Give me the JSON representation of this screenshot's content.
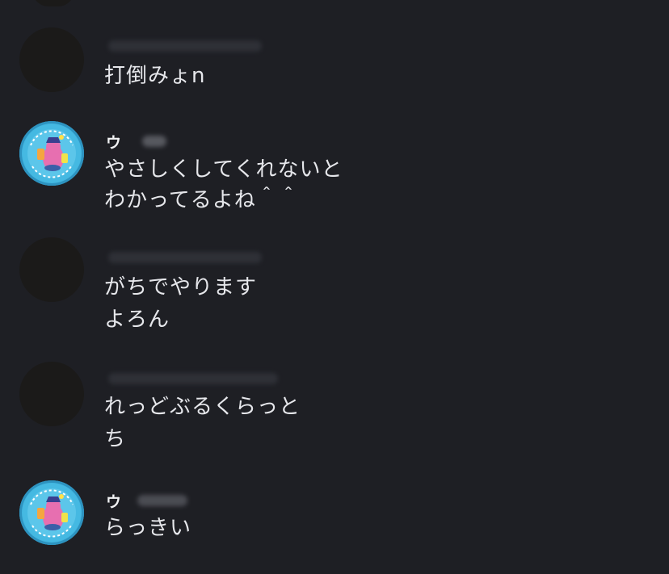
{
  "messages": [
    {
      "author": "",
      "lines": [
        "打倒みょn"
      ]
    },
    {
      "author": "ウ",
      "lines": [
        "やさしくしてくれないと",
        "わかってるよね＾＾"
      ]
    },
    {
      "author": "",
      "lines": [
        "がちでやります",
        "よろん"
      ]
    },
    {
      "author": "",
      "lines": [
        "れっどぶるくらっと",
        "ち"
      ]
    },
    {
      "author": "ウ",
      "lines": [
        "らっきい"
      ]
    }
  ],
  "colors": {
    "background": "#1e1f24",
    "text": "#e6e7eb",
    "mascot_badge": "#42b6e0"
  }
}
